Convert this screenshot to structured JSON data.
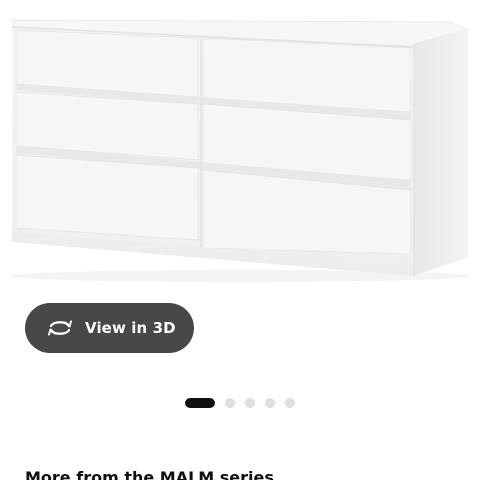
{
  "product_image": {
    "name": "MALM 6-drawer dresser, white",
    "drawer_count": 6
  },
  "view3d": {
    "label": "View in 3D",
    "icon": "rotate-3d-icon"
  },
  "carousel": {
    "total": 5,
    "active_index": 0
  },
  "more_section": {
    "heading": "More from the MALM series"
  },
  "colors": {
    "button_bg": "#484848",
    "dot_active": "#111111",
    "dot_inactive": "#dfdfdf"
  }
}
